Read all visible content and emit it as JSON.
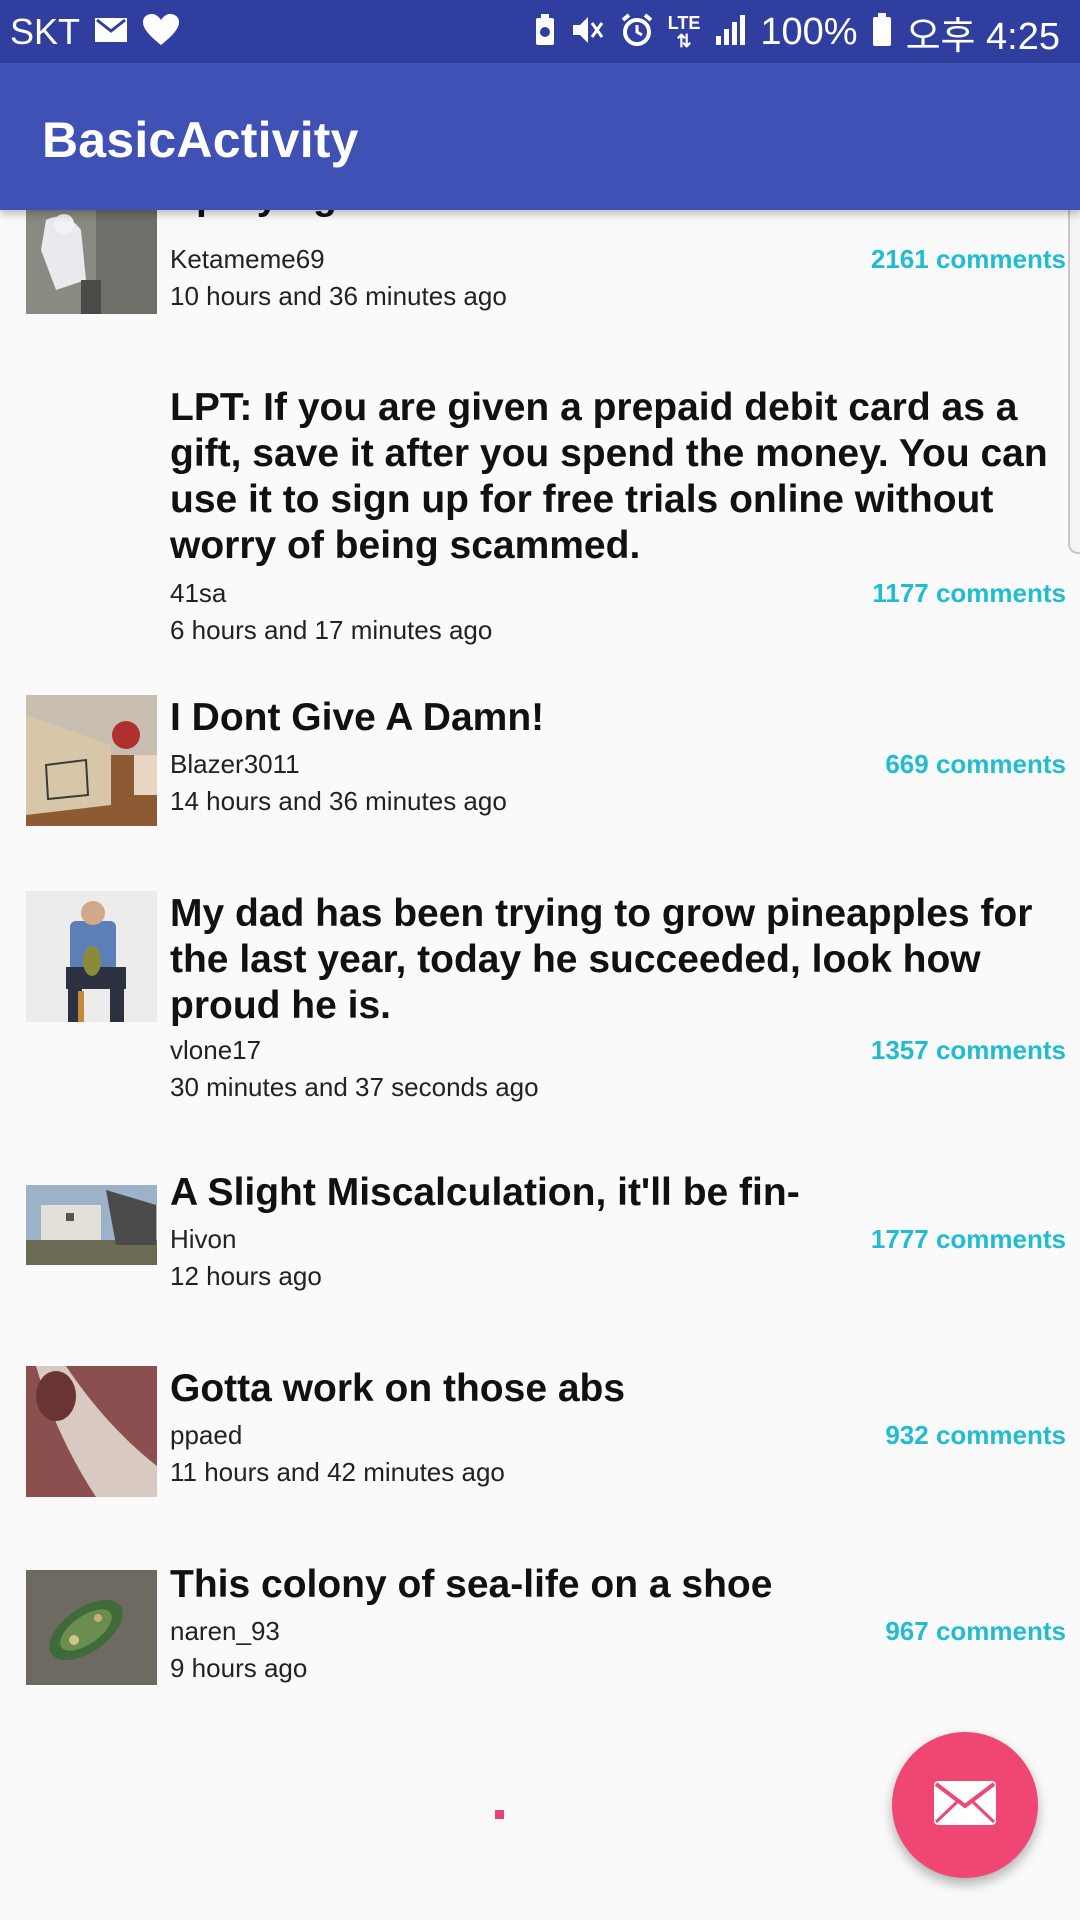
{
  "status_bar": {
    "carrier": "SKT",
    "battery": "100%",
    "time": "오후 4:25",
    "network": "LTE"
  },
  "app_bar": {
    "title": "BasicActivity"
  },
  "posts": [
    {
      "title": "Spraying insulator foam",
      "author": "Ketameme69",
      "time": "10 hours and 36 minutes ago",
      "comments": "2161 comments"
    },
    {
      "title": "LPT: If you are given a prepaid debit card as a gift, save it after you spend the money. You can use it to sign up for free trials online without worry of being scammed.",
      "author": "41sa",
      "time": "6 hours and 17 minutes ago",
      "comments": "1177 comments"
    },
    {
      "title": "I Dont Give A Damn!",
      "author": "Blazer3011",
      "time": "14 hours and 36 minutes ago",
      "comments": "669 comments"
    },
    {
      "title": "My dad has been trying to grow pineapples for the last year, today he succeeded, look how proud he is.",
      "author": "vlone17",
      "time": "30 minutes and 37 seconds ago",
      "comments": "1357 comments"
    },
    {
      "title": "A Slight Miscalculation, it'll be fin-",
      "author": "Hivon",
      "time": "12 hours ago",
      "comments": "1777 comments"
    },
    {
      "title": "Gotta work on those abs",
      "author": "ppaed",
      "time": "11 hours and 42 minutes ago",
      "comments": "932 comments"
    },
    {
      "title": "This colony of sea-life on a shoe",
      "author": "naren_93",
      "time": "9 hours ago",
      "comments": "967 comments"
    }
  ],
  "icons": {
    "fab": "mail-icon",
    "status": [
      "gmail-icon",
      "heart-icon",
      "battery-saver-icon",
      "vibrate-mute-icon",
      "alarm-icon",
      "signal-icon",
      "battery-icon"
    ]
  },
  "colors": {
    "primary": "#3f51b5",
    "primary_dark": "#303f9f",
    "accent": "#f04674",
    "comments": "#1fbcd2"
  }
}
